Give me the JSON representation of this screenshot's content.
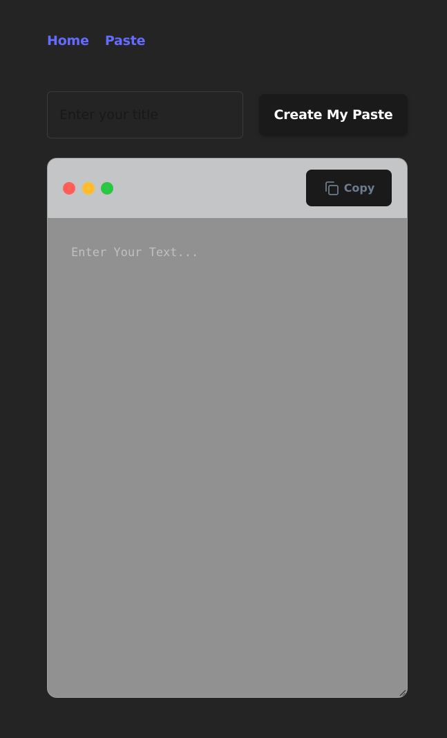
{
  "nav": {
    "home_label": "Home",
    "paste_label": "Paste"
  },
  "form": {
    "title_placeholder": "Enter your title",
    "title_value": "",
    "create_label": "Create My Paste"
  },
  "editor": {
    "copy_label": "Copy",
    "text_placeholder": "Enter Your Text...",
    "text_value": "",
    "window_dots": [
      "close-dot",
      "minimize-dot",
      "maximize-dot"
    ]
  },
  "colors": {
    "background": "#242424",
    "link": "#646cff",
    "button_bg": "#1a1a1a",
    "editor_header": "#c4c5c7",
    "editor_body": "#919191",
    "dot_red": "#ff5f57",
    "dot_yellow": "#febc2e",
    "dot_green": "#28c840",
    "copy_text": "#6e7c8f"
  },
  "icons": {
    "copy": "copy-icon",
    "resize": "resize-grip-icon"
  }
}
